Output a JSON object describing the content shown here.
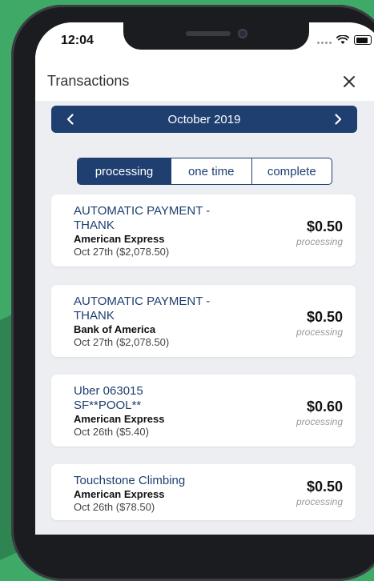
{
  "status_bar": {
    "time": "12:04"
  },
  "header": {
    "title": "Transactions"
  },
  "month_nav": {
    "label": "October 2019"
  },
  "segments": [
    {
      "label": "processing",
      "active": true
    },
    {
      "label": "one time",
      "active": false
    },
    {
      "label": "complete",
      "active": false
    }
  ],
  "transactions": [
    {
      "desc1": "AUTOMATIC PAYMENT -",
      "desc2": "THANK",
      "bank": "American Express",
      "date": "Oct 27th ($2,078.50)",
      "amount": "$0.50",
      "status": "processing"
    },
    {
      "desc1": "AUTOMATIC PAYMENT -",
      "desc2": "THANK",
      "bank": "Bank of America",
      "date": "Oct 27th ($2,078.50)",
      "amount": "$0.50",
      "status": "processing"
    },
    {
      "desc1": "Uber 063015",
      "desc2": "SF**POOL**",
      "bank": "American Express",
      "date": "Oct 26th ($5.40)",
      "amount": "$0.60",
      "status": "processing"
    },
    {
      "desc1": "Touchstone Climbing",
      "bank": "American Express",
      "date": "Oct 26th ($78.50)",
      "amount": "$0.50",
      "status": "processing"
    }
  ],
  "colors": {
    "primary": "#1e3f70",
    "background": "#3fa968",
    "screen": "#eceef1"
  }
}
